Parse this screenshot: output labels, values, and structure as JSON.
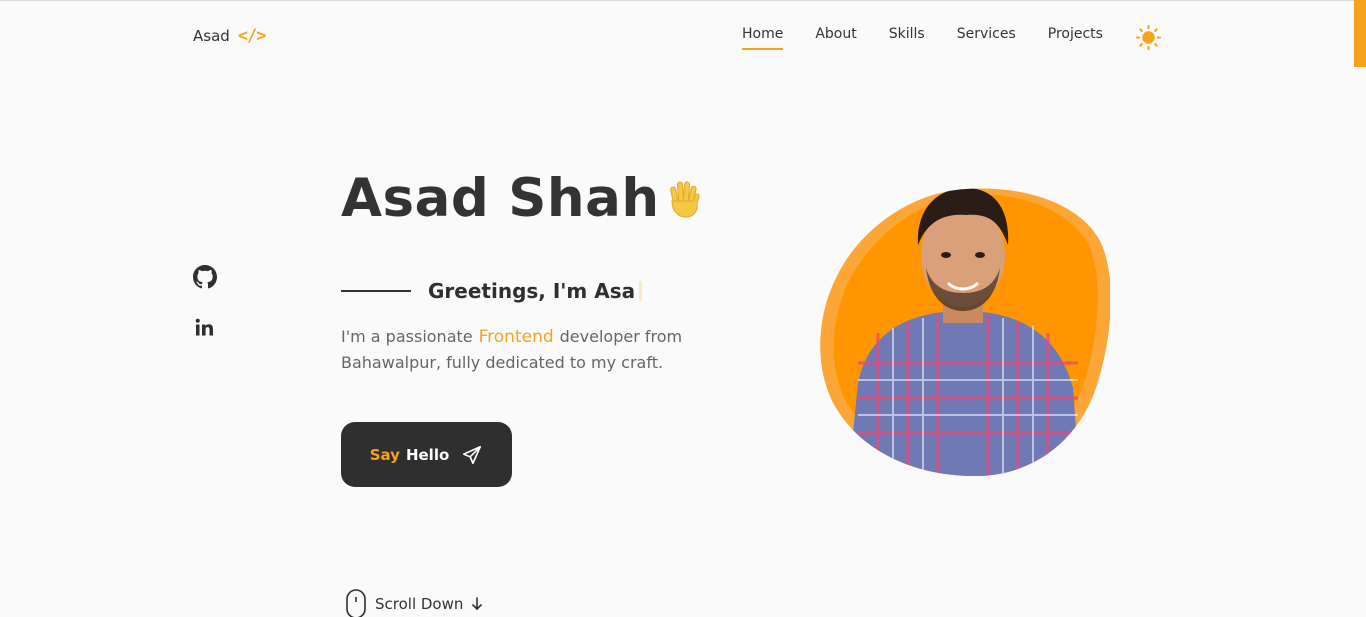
{
  "brand": {
    "name": "Asad",
    "icon": "code-icon",
    "icon_glyph": "</>"
  },
  "nav": {
    "items": [
      {
        "label": "Home",
        "active": true
      },
      {
        "label": "About",
        "active": false
      },
      {
        "label": "Skills",
        "active": false
      },
      {
        "label": "Services",
        "active": false
      },
      {
        "label": "Projects",
        "active": false
      }
    ],
    "theme_toggle_icon": "sun-icon"
  },
  "social": [
    {
      "icon": "github-icon"
    },
    {
      "icon": "linkedin-icon"
    }
  ],
  "hero": {
    "name": "Asad Shah",
    "wave_icon": "waving-hand-icon",
    "greeting": "Greetings, I'm Asa",
    "desc_before": "I'm a passionate",
    "desc_accent": "Frontend",
    "desc_after": "developer from Bahawalpur, fully dedicated to my craft.",
    "cta_word1": "Say",
    "cta_word2": "Hello",
    "cta_icon": "paper-plane-icon",
    "scroll_label": "Scroll Down",
    "scroll_icon": "mouse-icon"
  },
  "colors": {
    "accent": "#f7a21b",
    "dark": "#2f2f2f",
    "background": "#fafafa"
  }
}
